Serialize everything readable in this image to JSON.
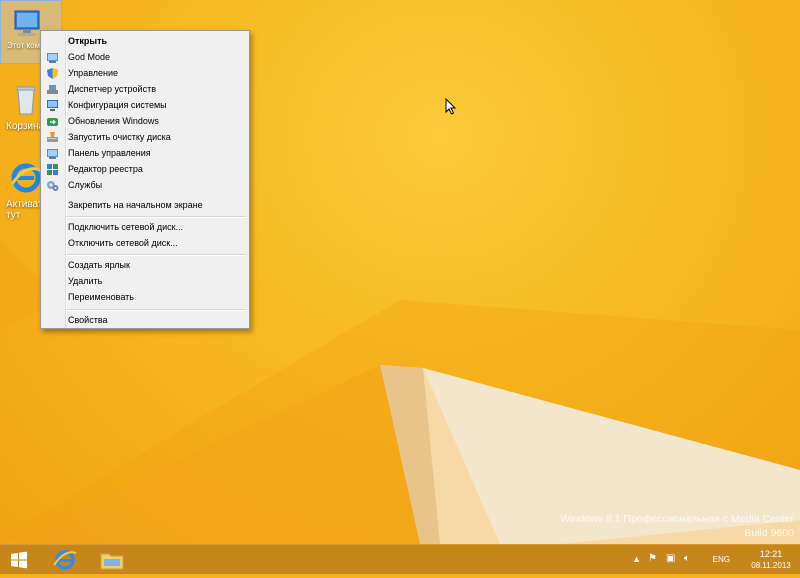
{
  "desktop": {
    "icons": [
      {
        "label": "Этот компьютер"
      },
      {
        "label": "Корзина"
      },
      {
        "label": "Активат тут"
      }
    ],
    "watermark": {
      "line1": "Windows 8.1 Профессиональная с Media Center",
      "line2": "Build 9600"
    }
  },
  "context_menu": {
    "items": [
      {
        "label": "Открыть",
        "icon": "none",
        "bold": true
      },
      {
        "label": "God Mode",
        "icon": "control-panel-icon"
      },
      {
        "label": "Управление",
        "icon": "shield-icon"
      },
      {
        "label": "Диспетчер устройств",
        "icon": "device-manager-icon"
      },
      {
        "label": "Конфигурация системы",
        "icon": "monitor-icon"
      },
      {
        "label": "Обновления Windows",
        "icon": "windows-update-icon"
      },
      {
        "label": "Запустить очистку диска",
        "icon": "disk-cleanup-icon"
      },
      {
        "label": "Панель управления",
        "icon": "control-panel-icon"
      },
      {
        "label": "Редактор реестра",
        "icon": "registry-icon"
      },
      {
        "label": "Службы",
        "icon": "services-icon"
      },
      {
        "label": "Закрепить на начальном экране",
        "icon": "none"
      },
      {
        "label": "Подключить сетевой диск...",
        "icon": "none"
      },
      {
        "label": "Отключить сетевой диск...",
        "icon": "none"
      },
      {
        "label": "Создать ярлык",
        "icon": "none"
      },
      {
        "label": "Удалить",
        "icon": "none"
      },
      {
        "label": "Переименовать",
        "icon": "none"
      },
      {
        "label": "Свойства",
        "icon": "none"
      }
    ]
  },
  "taskbar": {
    "language": "ENG",
    "time": "12:21",
    "date": "08.11.2013"
  },
  "colors": {
    "wallpaper": "#f6b21c",
    "taskbar": "#c7861c",
    "menu_bg": "#f0f0f0"
  }
}
